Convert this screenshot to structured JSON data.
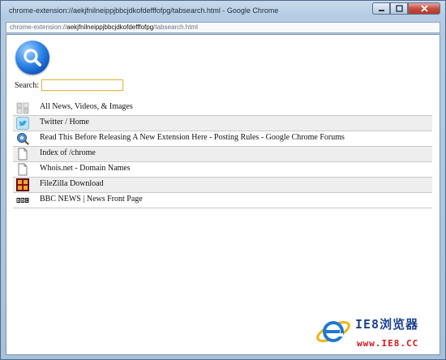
{
  "window": {
    "title": "chrome-extension://aekjfnilneippjbbcjdkofdefffofpg/tabsearch.html - Google Chrome",
    "controls": {
      "minimize": "▭",
      "maximize": "▭",
      "close": "✕"
    }
  },
  "urlbar": {
    "scheme": "chrome-extension://",
    "host": "aekjfnilneippjbbcjdkofdefffofpg",
    "path": "/tabsearch.html"
  },
  "search": {
    "label": "Search:",
    "value": "",
    "placeholder": ""
  },
  "results": [
    {
      "title": "All News, Videos, & Images",
      "icon": "google-news-icon"
    },
    {
      "title": "Twitter / Home",
      "icon": "twitter-bird-icon"
    },
    {
      "title": "Read This Before Releasing A New Extension Here - Posting Rules - Google Chrome Forums",
      "icon": "chrome-forum-icon"
    },
    {
      "title": "Index of /chrome",
      "icon": "blank-page-icon"
    },
    {
      "title": "Whois.net - Domain Names",
      "icon": "blank-page-icon"
    },
    {
      "title": "FileZilla Download",
      "icon": "filezilla-icon"
    },
    {
      "title": "BBC NEWS | News Front Page",
      "icon": "bbc-icon"
    }
  ],
  "watermark": {
    "text": "IE8浏览器",
    "url": "www.IE8.CC"
  },
  "colors": {
    "accent": "#2f86e8",
    "row_alt": "#eeeeee",
    "input_border": "#e0b65c",
    "watermark_blue": "#1b3f8f",
    "watermark_red": "#d8141b"
  }
}
